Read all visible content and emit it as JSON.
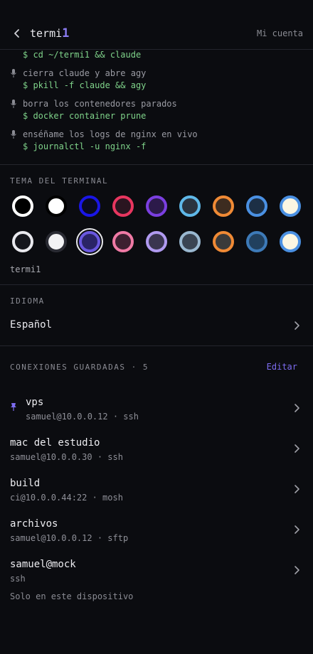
{
  "header": {
    "brand_text": "termi",
    "brand_accent": "1",
    "account_label": "Mi cuenta"
  },
  "history": [
    {
      "command": "$ cd ~/termi1 && claude"
    },
    {
      "prompt": "cierra claude y abre agy",
      "command": "$ pkill -f claude && agy"
    },
    {
      "prompt": "borra los contenedores parados",
      "command": "$ docker container prune"
    },
    {
      "prompt": "enséñame los logs de nginx en vivo",
      "command": "$ journalctl -u nginx -f"
    }
  ],
  "theme": {
    "title": "TEMA DEL TERMINAL",
    "selected_name": "termi1",
    "row1": [
      {
        "fill": "#000000",
        "ring": "#ffffff"
      },
      {
        "fill": "#ffffff",
        "ring": "#000000"
      },
      {
        "fill": "#0a0a20",
        "ring": "#1a16e6"
      },
      {
        "fill": "#2a1520",
        "ring": "#e8365f"
      },
      {
        "fill": "#2c1a4a",
        "ring": "#7b3fe0"
      },
      {
        "fill": "#2a3440",
        "ring": "#5fb8e8"
      },
      {
        "fill": "#3d2c20",
        "ring": "#f08a35"
      },
      {
        "fill": "#1c2f45",
        "ring": "#4a90e2"
      },
      {
        "fill": "#fbf6e2",
        "ring": "#4a90e2"
      }
    ],
    "row2": [
      {
        "fill": "#15161c",
        "ring": "#e9e9ee"
      },
      {
        "fill": "#f2f2f4",
        "ring": "#2a2b33"
      },
      {
        "fill": "#2a2466",
        "ring": "#6a58e0",
        "selected": true
      },
      {
        "fill": "#3d2030",
        "ring": "#f07aa5"
      },
      {
        "fill": "#3a3550",
        "ring": "#b09af0"
      },
      {
        "fill": "#3a4452",
        "ring": "#9ab8d0"
      },
      {
        "fill": "#3a3a3a",
        "ring": "#f08a35"
      },
      {
        "fill": "#21405e",
        "ring": "#3d7ab8"
      },
      {
        "fill": "#fbf6e2",
        "ring": "#4a90e2"
      }
    ]
  },
  "language": {
    "title": "IDIOMA",
    "value": "Español"
  },
  "connections": {
    "title": "CONEXIONES GUARDADAS · 5",
    "edit_label": "Editar",
    "items": [
      {
        "name": "vps",
        "detail": "samuel@10.0.0.12 · ssh",
        "pinned": true
      },
      {
        "name": "mac del estudio",
        "detail": "samuel@10.0.0.30 · ssh"
      },
      {
        "name": "build",
        "detail": "ci@10.0.0.44:22 · mosh"
      },
      {
        "name": "archivos",
        "detail": "samuel@10.0.0.12 · sftp"
      },
      {
        "name": "samuel@mock",
        "detail": "ssh"
      }
    ],
    "footnote": "Solo en este dispositivo"
  },
  "colors": {
    "accent": "#8b7cf2",
    "command_green": "#7fd38a",
    "background": "#0b0c10"
  },
  "icons": {
    "back": "chevron-left-icon",
    "mic": "microphone-icon",
    "pin": "pin-icon",
    "chevron": "chevron-right-icon"
  }
}
